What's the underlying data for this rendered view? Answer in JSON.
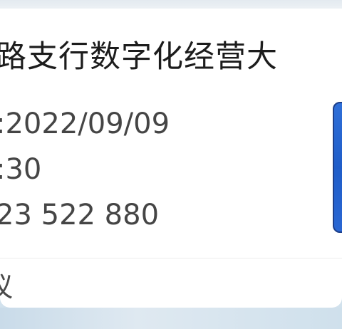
{
  "card": {
    "title": "路支行数字化经营大",
    "date_line": ":2022/09/09",
    "time_line": ":30",
    "id_line": "23 522 880",
    "footer_label": "议"
  },
  "colors": {
    "thumbnail_accent": "#2a67d3"
  }
}
